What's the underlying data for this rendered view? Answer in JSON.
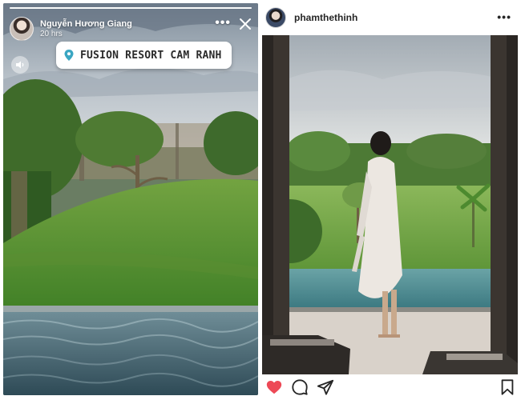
{
  "story": {
    "username": "Nguyễn Hương Giang",
    "time": "20 hrs",
    "more_label": "•••",
    "location": "FUSION RESORT CAM RANH",
    "progress": 1.0
  },
  "post": {
    "username": "phamthethinh",
    "more_label": "•••",
    "liked": true
  },
  "colors": {
    "like_red": "#ed4956",
    "location_pin": "#3aa6c2",
    "text_dark": "#262626"
  },
  "icons": {
    "story_close": "close-icon",
    "story_sound": "speaker-icon",
    "location": "location-pin-icon",
    "like": "heart-icon",
    "comment": "comment-icon",
    "share": "paper-plane-icon",
    "save": "bookmark-icon"
  }
}
